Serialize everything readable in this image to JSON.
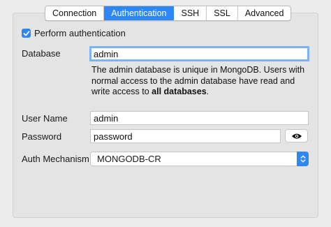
{
  "tabs": [
    "Connection",
    "Authentication",
    "SSH",
    "SSL",
    "Advanced"
  ],
  "active_tab": "Authentication",
  "perform_auth": {
    "label": "Perform authentication",
    "checked": true
  },
  "database": {
    "label": "Database",
    "value": "admin",
    "help_text_before": "The admin database is unique in MongoDB. Users with normal access to the admin database have read and write access to ",
    "help_text_bold": "all databases",
    "help_text_after": "."
  },
  "username": {
    "label": "User Name",
    "value": "admin"
  },
  "password": {
    "label": "Password",
    "value": "password",
    "reveal_icon": "eye-icon"
  },
  "auth_mechanism": {
    "label": "Auth Mechanism",
    "value": "MONGODB-CR"
  },
  "colors": {
    "accent": "#2d87f7",
    "focus_ring": "#7fb2f3"
  }
}
